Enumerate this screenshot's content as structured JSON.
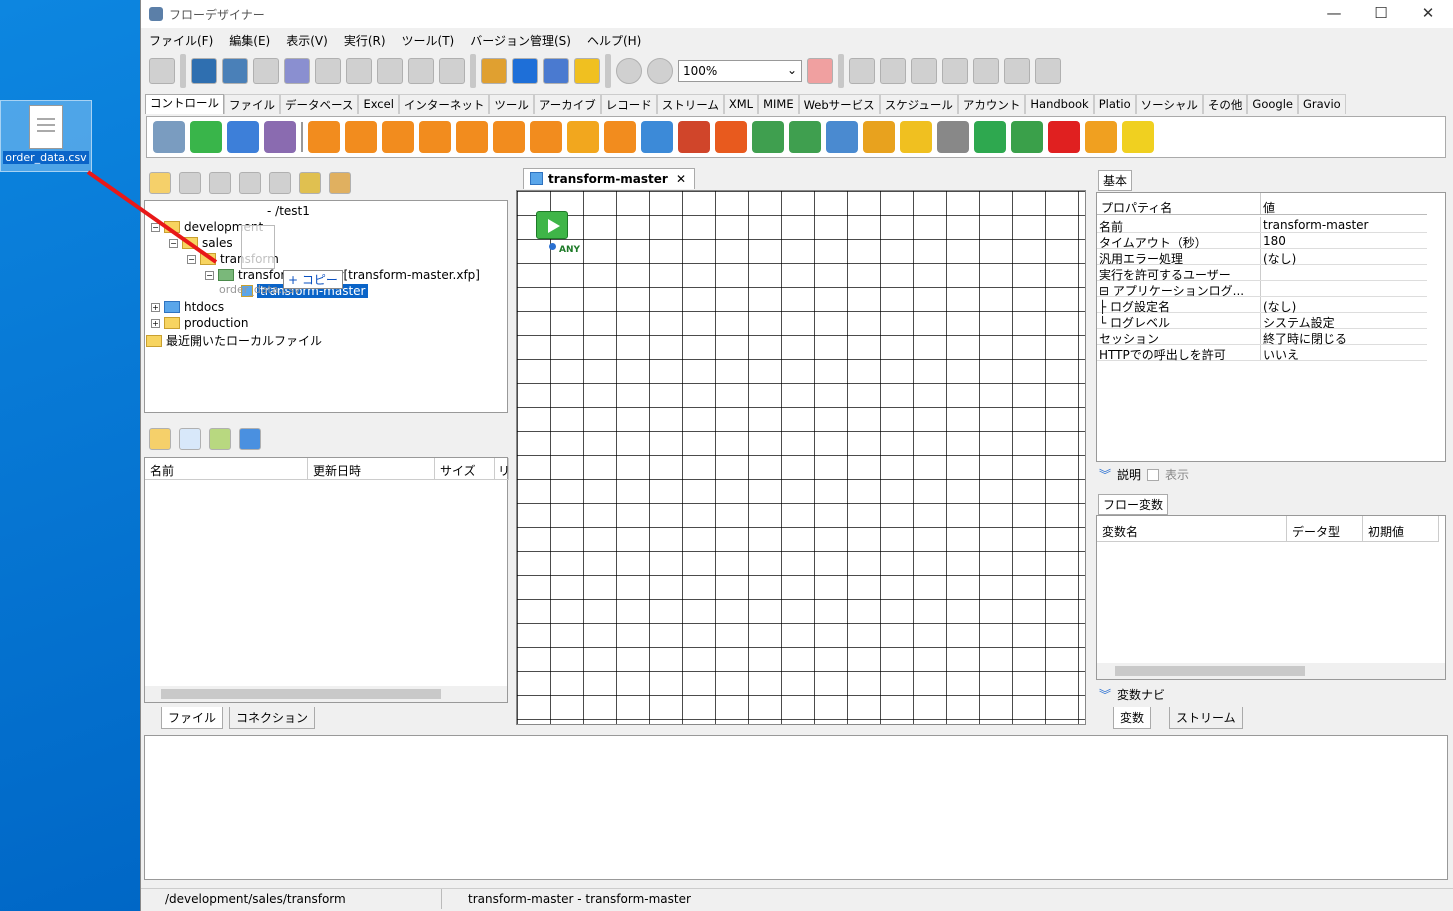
{
  "desktop": {
    "file_icon_label": "order_data.csv"
  },
  "window": {
    "title": "フローデザイナー",
    "minimize": "—",
    "maximize": "☐",
    "close": "✕"
  },
  "menu": [
    "ファイル(F)",
    "編集(E)",
    "表示(V)",
    "実行(R)",
    "ツール(T)",
    "バージョン管理(S)",
    "ヘルプ(H)"
  ],
  "toolbar": {
    "zoom_value": "100%",
    "zoom_arrow": "⌄"
  },
  "palette_tabs": [
    "コントロール",
    "ファイル",
    "データベース",
    "Excel",
    "インターネット",
    "ツール",
    "アーカイブ",
    "レコード",
    "ストリーム",
    "XML",
    "MIME",
    "Webサービス",
    "スケジュール",
    "アカウント",
    "Handbook",
    "Platio",
    "ソーシャル",
    "その他",
    "Google",
    "Gravio"
  ],
  "palette_colors": [
    "#7a9cc0",
    "#39b54a",
    "#3d7fd9",
    "#8a6bb0",
    "#f28c1e",
    "#f28c1e",
    "#f28c1e",
    "#f28c1e",
    "#f28c1e",
    "#f28c1e",
    "#f28c1e",
    "#f2a71e",
    "#f28c1e",
    "#3c8ad8",
    "#d0452a",
    "#e85a1e",
    "#3f9f4f",
    "#3f9f4f",
    "#4a8ad0",
    "#e8a21e",
    "#f0c020",
    "#888888",
    "#2ea84f",
    "#3aa04a",
    "#e02020",
    "#f0a020",
    "#f0d020"
  ],
  "repository": {
    "root": "- /test1",
    "items": [
      {
        "label": "development",
        "toggle": "−"
      },
      {
        "label": "sales",
        "toggle": "−"
      },
      {
        "label": "transform",
        "toggle": "−"
      },
      {
        "label": "transform-master[transform-master.xfp]",
        "toggle": "−"
      },
      {
        "label": "transform-master"
      },
      {
        "label": "htdocs",
        "toggle": "+"
      },
      {
        "label": "production",
        "toggle": "+"
      },
      {
        "label": "最近開いたローカルファイル"
      }
    ],
    "drag_tooltip": "+ コピー",
    "drag_ghost_label": "order_data.csv"
  },
  "file_table": {
    "columns": [
      "名前",
      "更新日時",
      "サイズ",
      "リ"
    ]
  },
  "left_tabs": [
    "ファイル",
    "コネクション"
  ],
  "editor": {
    "tab_label": "transform-master",
    "tab_close": "✕",
    "start_label": "ANY"
  },
  "properties": {
    "tab": "基本",
    "columns": [
      "プロパティ名",
      "値"
    ],
    "rows": [
      {
        "name": "名前",
        "value": "transform-master"
      },
      {
        "name": "タイムアウト（秒）",
        "value": "180"
      },
      {
        "name": "汎用エラー処理",
        "value": "(なし)"
      },
      {
        "name": "実行を許可するユーザー",
        "value": ""
      },
      {
        "name": "⊟ アプリケーションログ...",
        "value": ""
      },
      {
        "name": "├ ログ設定名",
        "value": "(なし)"
      },
      {
        "name": "└ ログレベル",
        "value": "システム設定"
      },
      {
        "name": "セッション",
        "value": "終了時に閉じる"
      },
      {
        "name": "HTTPでの呼出しを許可",
        "value": "いいえ"
      }
    ],
    "description_label": "説明",
    "show_label": "表示"
  },
  "flow_vars": {
    "tab": "フロー変数",
    "columns": [
      "変数名",
      "データ型",
      "初期値"
    ],
    "navi_label": "変数ナビ"
  },
  "right_tabs": [
    "変数",
    "ストリーム"
  ],
  "status": {
    "path": "/development/sales/transform",
    "flow": "transform-master - transform-master"
  }
}
